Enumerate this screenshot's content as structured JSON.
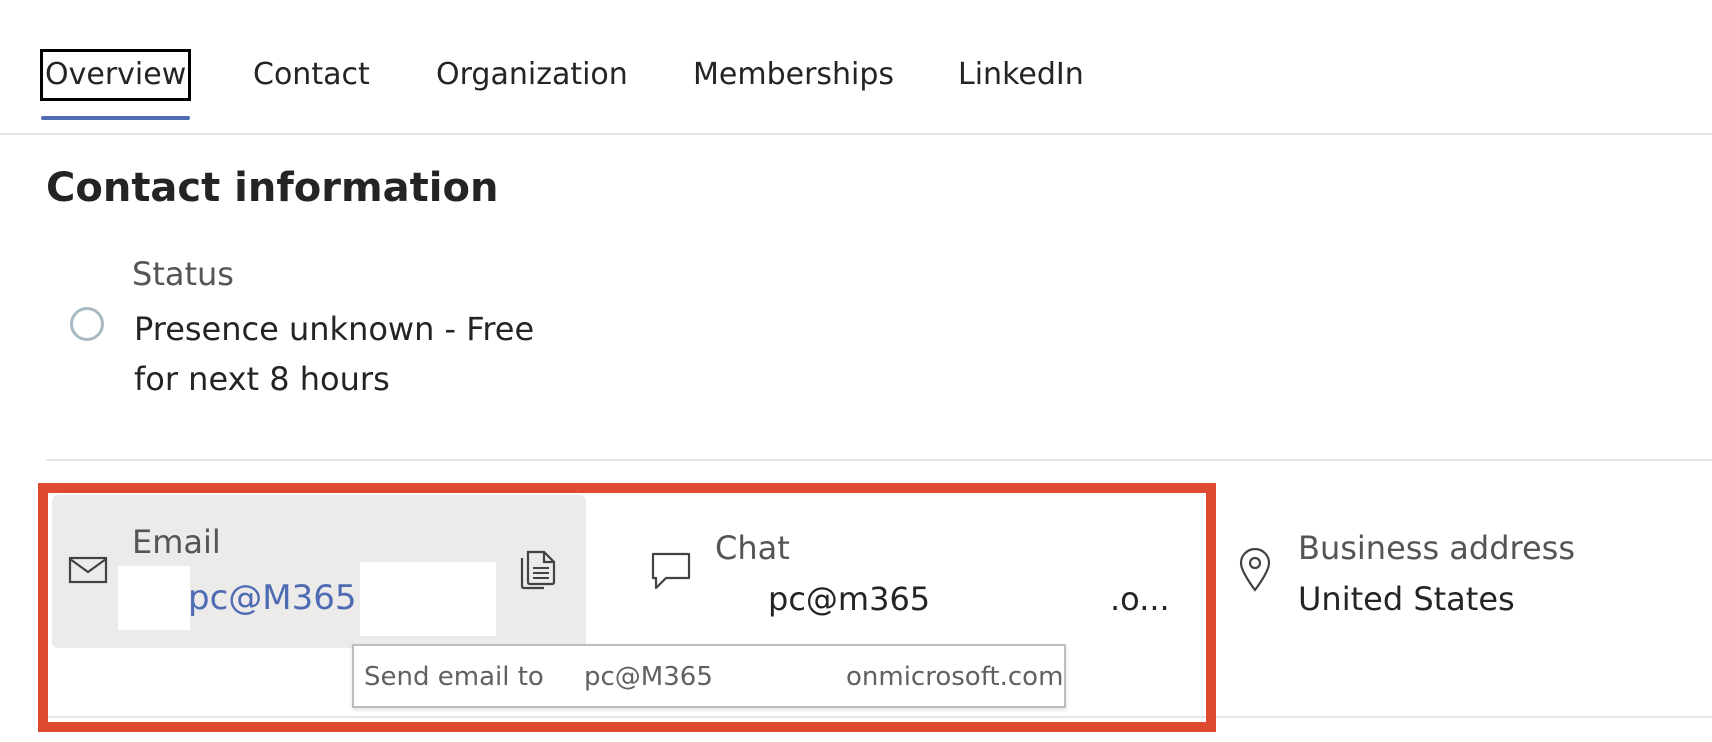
{
  "tabs": [
    {
      "label": "Overview",
      "selected": true
    },
    {
      "label": "Contact",
      "selected": false
    },
    {
      "label": "Organization",
      "selected": false
    },
    {
      "label": "Memberships",
      "selected": false
    },
    {
      "label": "LinkedIn",
      "selected": false
    }
  ],
  "section": {
    "title": "Contact information"
  },
  "status": {
    "label": "Status",
    "value": "Presence unknown - Free for next 8 hours",
    "icon": "presence-unknown-circle-icon"
  },
  "email": {
    "label": "Email",
    "value": "pc@M365",
    "icon": "mail-icon",
    "copy_icon": "copy-icon"
  },
  "chat": {
    "label": "Chat",
    "value": "pc@m365",
    "tail": ".o...",
    "icon": "chat-bubble-icon"
  },
  "business_address": {
    "label": "Business address",
    "value": "United States",
    "icon": "location-pin-icon"
  },
  "tooltip": {
    "prefix": "Send email to",
    "local": "pc@M365",
    "domain": "onmicrosoft.com"
  },
  "colors": {
    "accent": "#4f6bb4",
    "highlight": "#dc4b31",
    "hover_background": "#edebe9"
  }
}
